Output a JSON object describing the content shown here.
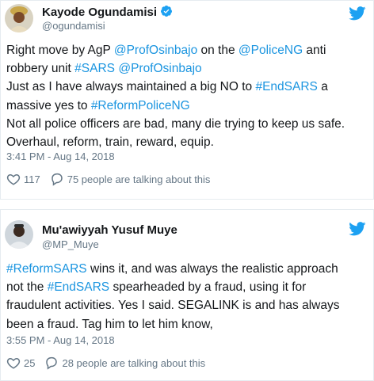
{
  "colors": {
    "link": "#1b95e0",
    "muted": "#657786",
    "text": "#14171a",
    "border": "#e6ecf0",
    "verified": "#1da1f2"
  },
  "tweets": [
    {
      "author_name": "Kayode Ogundamisi",
      "handle": "@ogundamisi",
      "verified": true,
      "lines": [
        [
          {
            "t": "Right move by AgP ",
            "link": false
          },
          {
            "t": "@ProfOsinbajo",
            "link": true
          },
          {
            "t": " on the ",
            "link": false
          },
          {
            "t": "@PoliceNG",
            "link": true
          },
          {
            "t": " anti",
            "link": false
          }
        ],
        [
          {
            "t": "robbery unit ",
            "link": false
          },
          {
            "t": "#SARS",
            "link": true
          },
          {
            "t": " ",
            "link": false
          },
          {
            "t": "@ProfOsinbajo",
            "link": true
          }
        ],
        [
          {
            "t": "Just as I have always maintained a big NO to ",
            "link": false
          },
          {
            "t": "#EndSARS",
            "link": true
          },
          {
            "t": " a",
            "link": false
          }
        ],
        [
          {
            "t": "massive yes to ",
            "link": false
          },
          {
            "t": "#ReformPoliceNG",
            "link": true
          }
        ],
        [
          {
            "t": "Not all police officers are bad, many die trying to keep us safe.",
            "link": false
          }
        ],
        [
          {
            "t": "Overhaul, reform, train, reward, equip.",
            "link": false
          }
        ]
      ],
      "timestamp": "3:41 PM - Aug 14, 2018",
      "likes": "117",
      "talking": "75 people are talking about this"
    },
    {
      "author_name": "Mu'awiyyah Yusuf Muye",
      "handle": "@MP_Muye",
      "verified": false,
      "lines": [
        [
          {
            "t": "#ReformSARS",
            "link": true
          },
          {
            "t": " wins it, and was always the realistic approach",
            "link": false
          }
        ],
        [
          {
            "t": "not the ",
            "link": false
          },
          {
            "t": "#EndSARS",
            "link": true
          },
          {
            "t": " spearheaded by a fraud, using it for",
            "link": false
          }
        ],
        [
          {
            "t": "fraudulent activities. Yes I said. SEGALINK is and has always",
            "link": false
          }
        ],
        [
          {
            "t": "been a fraud. Tag him to let him know,",
            "link": false
          }
        ]
      ],
      "timestamp": "3:55 PM - Aug 14, 2018",
      "likes": "25",
      "talking": "28 people are talking about this"
    }
  ]
}
